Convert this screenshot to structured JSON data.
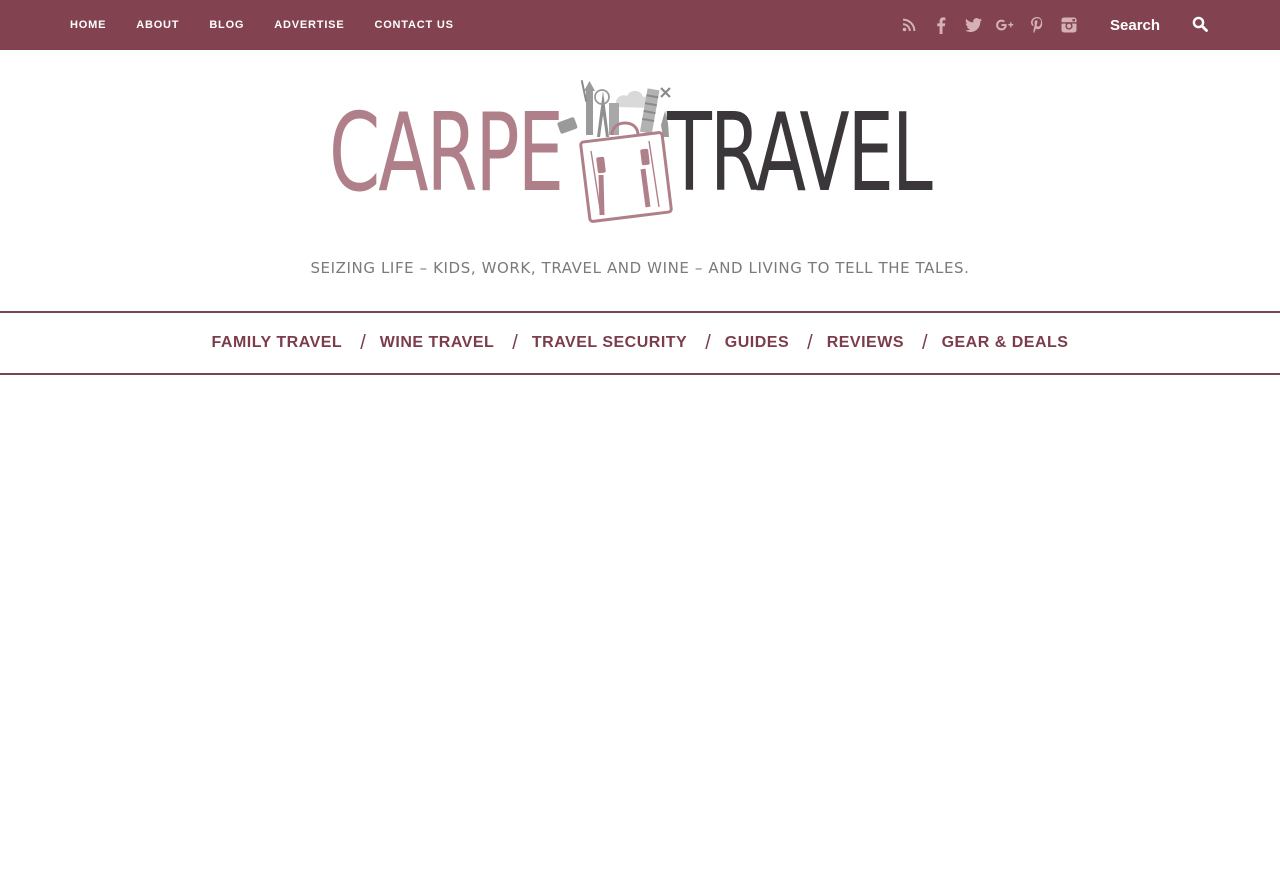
{
  "top_nav": {
    "items": [
      {
        "label": "HOME"
      },
      {
        "label": "ABOUT"
      },
      {
        "label": "BLOG"
      },
      {
        "label": "ADVERTISE"
      },
      {
        "label": "CONTACT US"
      }
    ]
  },
  "social_icons": [
    "rss-icon",
    "facebook-icon",
    "twitter-icon",
    "google-plus-icon",
    "pinterest-icon",
    "instagram-icon"
  ],
  "search": {
    "placeholder": "Search",
    "icon": "search-icon"
  },
  "logo": {
    "word1": "CARPE",
    "word2": "TRAVEL"
  },
  "tagline": "SEIZING LIFE – KIDS, WORK, TRAVEL AND WINE – AND LIVING TO TELL THE TALES.",
  "category_nav": {
    "separator": "/",
    "items": [
      {
        "label": "FAMILY TRAVEL"
      },
      {
        "label": "WINE TRAVEL"
      },
      {
        "label": "TRAVEL SECURITY"
      },
      {
        "label": "GUIDES"
      },
      {
        "label": "REVIEWS"
      },
      {
        "label": "GEAR & DEALS"
      }
    ]
  },
  "colors": {
    "topbar": "#82424f",
    "brand_rose": "#b0808a",
    "brand_dark": "#3a363a",
    "nav_text": "#7b3d4b",
    "social_icon": "#d4b0b7"
  }
}
